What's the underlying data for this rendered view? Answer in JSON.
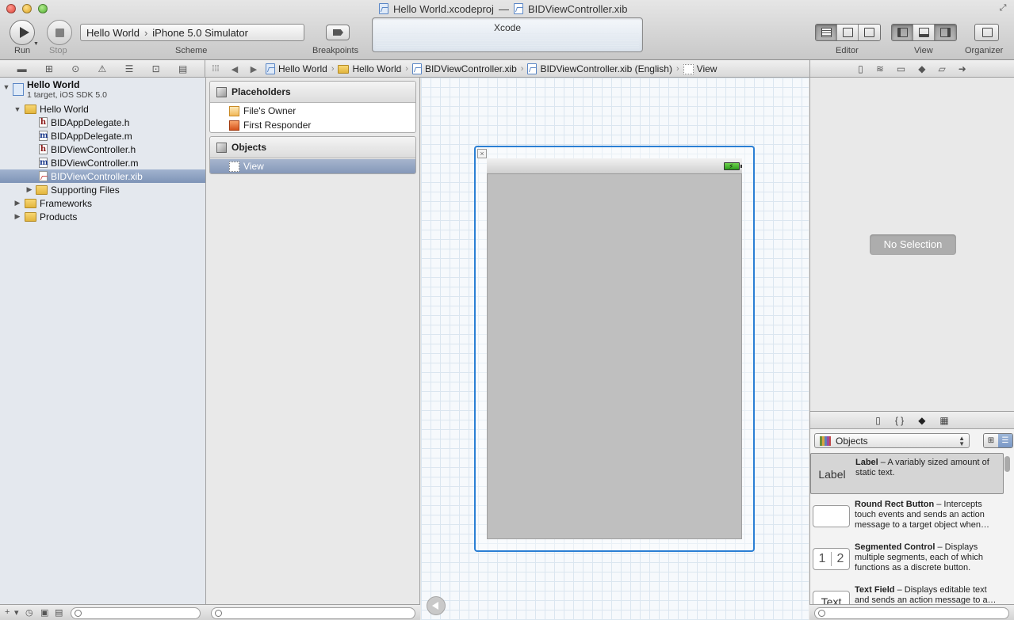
{
  "window": {
    "title_project": "Hello World.xcodeproj",
    "title_sep": "—",
    "title_file": "BIDViewController.xib"
  },
  "toolbar": {
    "run_label": "Run",
    "stop_label": "Stop",
    "scheme_label": "Scheme",
    "scheme_target": "Hello World",
    "scheme_sep": "›",
    "scheme_destination": "iPhone 5.0 Simulator",
    "breakpoints_label": "Breakpoints",
    "activity_text": "Xcode",
    "editor_label": "Editor",
    "view_label": "View",
    "organizer_label": "Organizer"
  },
  "jumpbar": {
    "crumbs": [
      "Hello World",
      "Hello World",
      "BIDViewController.xib",
      "BIDViewController.xib (English)",
      "View"
    ],
    "sep": "›"
  },
  "navigator": {
    "project_name": "Hello World",
    "project_sub": "1 target, iOS SDK 5.0",
    "group": "Hello World",
    "files": [
      "BIDAppDelegate.h",
      "BIDAppDelegate.m",
      "BIDViewController.h",
      "BIDViewController.m",
      "BIDViewController.xib"
    ],
    "file_badges": [
      "h",
      "m",
      "h",
      "m",
      ""
    ],
    "supporting": "Supporting Files",
    "frameworks": "Frameworks",
    "products": "Products"
  },
  "outline": {
    "placeholders_title": "Placeholders",
    "placeholders": [
      "File's Owner",
      "First Responder"
    ],
    "objects_title": "Objects",
    "objects": [
      "View"
    ]
  },
  "inspector": {
    "no_selection": "No Selection"
  },
  "library": {
    "popup": "Objects",
    "items": [
      {
        "thumb": "Label",
        "name": "Label",
        "desc": " – A variably sized amount of static text."
      },
      {
        "thumb": "",
        "name": "Round Rect Button",
        "desc": " – Intercepts touch events and sends an action message to a target object when…"
      },
      {
        "thumb": "",
        "name": "Segmented Control",
        "desc": " – Displays multiple segments, each of which functions as a discrete button."
      },
      {
        "thumb": "Text",
        "name": "Text Field",
        "desc": " – Displays editable text and sends an action message to a…"
      }
    ],
    "seg_thumb": [
      "1",
      "2"
    ]
  },
  "colors": {
    "selection": "#7e94b7",
    "canvas_frame": "#2b7fd4",
    "view_gray": "#bfbfbf"
  }
}
